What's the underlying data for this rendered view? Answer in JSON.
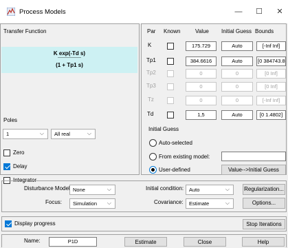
{
  "window": {
    "title": "Process Models",
    "minimize": "—",
    "maximize": "☐",
    "close": "✕"
  },
  "transfer": {
    "label": "Transfer Function",
    "numerator": "K exp(-Td s)",
    "separator": "-----------------",
    "denominator": "(1 + Tp1 s)"
  },
  "poles": {
    "label": "Poles",
    "count": "1",
    "type": "All real"
  },
  "options": {
    "zero": "Zero",
    "delay": "Delay",
    "integrator": "Integrator"
  },
  "params": {
    "headers": [
      "Par",
      "Known",
      "Value",
      "Initial Guess",
      "Bounds"
    ],
    "rows": [
      {
        "name": "K",
        "value": "175.729",
        "guess": "Auto",
        "bounds": "[-Inf Inf]"
      },
      {
        "name": "Tp1",
        "value": "384.6616",
        "guess": "Auto",
        "bounds": "[0 384743.80"
      },
      {
        "name": "Tp2",
        "value": "0",
        "guess": "0",
        "bounds": "[0 Inf]"
      },
      {
        "name": "Tp3",
        "value": "0",
        "guess": "0",
        "bounds": "[0 Inf]"
      },
      {
        "name": "Tz",
        "value": "0",
        "guess": "0",
        "bounds": "[-Inf Inf]"
      },
      {
        "name": "Td",
        "value": "1,5",
        "guess": "Auto",
        "bounds": "[0 1.4802]"
      }
    ]
  },
  "initial_guess": {
    "label": "Initial Guess",
    "auto": "Auto-selected",
    "from_model": "From existing model:",
    "from_model_value": "",
    "user": "User-defined",
    "value_btn": "Value-->Initial Guess"
  },
  "settings": {
    "disturbance_label": "Disturbance Model:",
    "disturbance_value": "None",
    "focus_label": "Focus:",
    "focus_value": "Simulation",
    "init_cond_label": "Initial condition:",
    "init_cond_value": "Auto",
    "covariance_label": "Covariance:",
    "covariance_value": "Estimate",
    "regularization_btn": "Regularization...",
    "options_btn": "Options..."
  },
  "progress": {
    "display_label": "Display progress",
    "stop_btn": "Stop Iterations"
  },
  "footer": {
    "name_label": "Name:",
    "name_value": "P1D",
    "estimate_btn": "Estimate",
    "close_btn": "Close",
    "help_btn": "Help"
  }
}
